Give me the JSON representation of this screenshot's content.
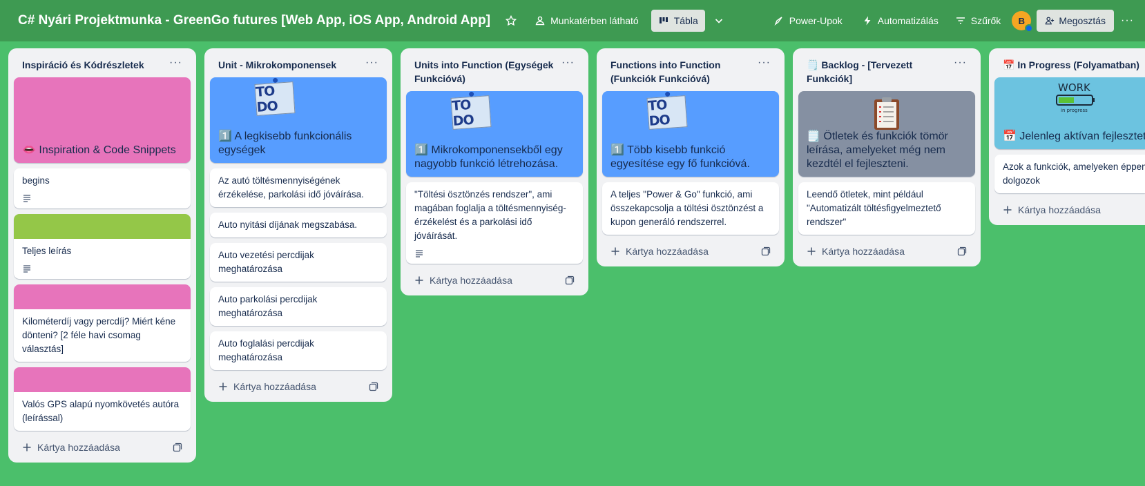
{
  "header": {
    "title": "C# Nyári Projektmunka - GreenGo futures [Web App, iOS App, Android App]",
    "visibility": "Munkatérben látható",
    "view": "Tábla",
    "powerups": "Power-Upok",
    "automation": "Automatizálás",
    "filters": "Szűrők",
    "avatar_letter": "B",
    "share": "Megosztás"
  },
  "add_card_label": "Kártya hozzáadása",
  "lists": [
    {
      "title": "Inspiráció és Kódrészletek",
      "cover_title": "👄 Inspiration & Code Snippets",
      "cards": [
        "begins",
        "Teljes leírás",
        "Kilométerdíj vagy percdíj? Miért kéne dönteni? [2 féle havi csomag választás]",
        "Valós GPS alapú nyomkövetés autóra (leírással)"
      ]
    },
    {
      "title": "Unit - Mikrokomponensek",
      "cover_title": "1️⃣ A legkisebb funkcionális egységek",
      "cards": [
        "Az autó töltésmennyiségének érzékelése, parkolási idő jóváírása.",
        "Auto nyitási díjának megszabása.",
        "Auto vezetési percdijak meghatározása",
        "Auto parkolási percdijak meghatározása",
        "Auto foglalási percdijak meghatározása"
      ]
    },
    {
      "title": "Units into Function (Egységek Funkcióvá)",
      "cover_title": "1️⃣ Mikrokomponensekből egy nagyobb funkció létrehozása.",
      "cards": [
        "\"Töltési ösztönzés rendszer\", ami magában foglalja a töltésmennyiség-érzékelést és a parkolási idő jóváírását."
      ]
    },
    {
      "title": "Functions into Function (Funkciók Funkcióvá)",
      "cover_title": "1️⃣ Több kisebb funkció egyesítése egy fő funkcióvá.",
      "cards": [
        "A teljes \"Power & Go\" funkció, ami összekapcsolja a töltési ösztönzést a kupon generáló rendszerrel."
      ]
    },
    {
      "title": "🗒️ Backlog - [Tervezett Funkciók]",
      "cover_title": "🗒️ Ötletek és funkciók tömör leírása, amelyeket még nem kezdtél el fejleszteni.",
      "cards": [
        "Leendő ötletek, mint például \"Automatizált töltésfigyelmeztető rendszer\""
      ]
    },
    {
      "title": "📅 In Progress (Folyamatban)",
      "cover_title": "📅 Jelenleg aktívan fejlesztett funkciók és feladatok.",
      "cards": [
        "Azok a funkciók, amelyeken éppen dolgozok"
      ]
    }
  ],
  "sticker_text": "TO DO",
  "colors": {
    "background": "#4bbf6b",
    "header": "#3e9a52",
    "pink": "#e774bb",
    "lime": "#94c748",
    "blue": "#579dff",
    "gray": "#8590a2",
    "teal": "#6cc3e0"
  }
}
